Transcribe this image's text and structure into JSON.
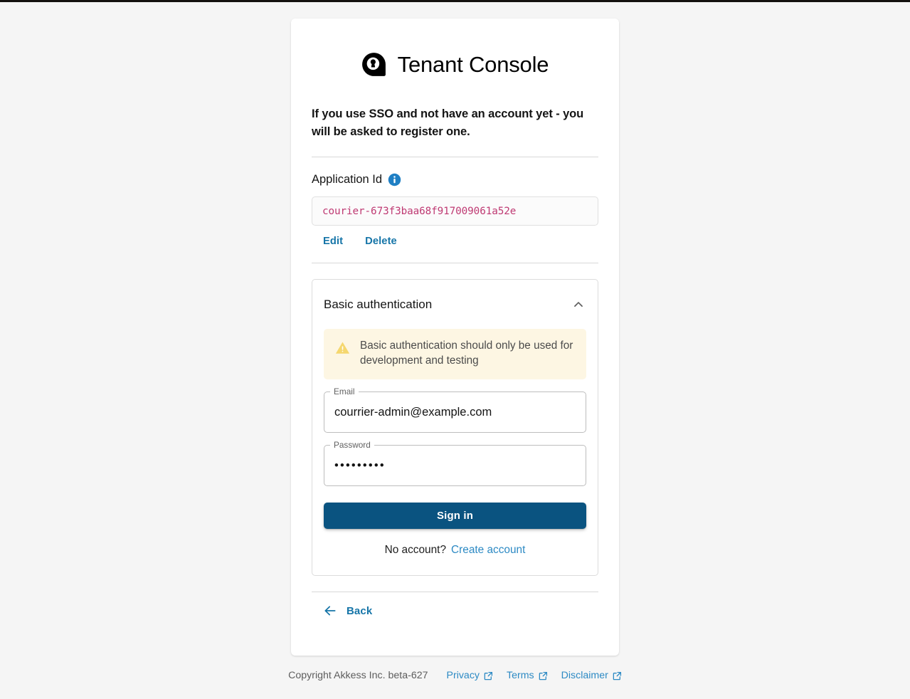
{
  "brand": {
    "logo_icon": "akkess-pin-lock-logo",
    "title": "Tenant Console"
  },
  "intro": {
    "text": "If you use SSO and not have an account yet - you will be asked to register one."
  },
  "application_id": {
    "label": "Application Id",
    "info_icon": "info-circle-icon",
    "value": "courier-673f3baa68f917009061a52e",
    "edit_label": "Edit",
    "delete_label": "Delete"
  },
  "basic_auth": {
    "title": "Basic authentication",
    "collapse_icon": "chevron-up-icon",
    "expanded": true,
    "warning": {
      "icon": "warning-triangle-icon",
      "text": "Basic authentication should only be used for development and testing"
    },
    "email": {
      "label": "Email",
      "value": "courrier-admin@example.com",
      "placeholder": ""
    },
    "password": {
      "label": "Password",
      "value": "•••••••••",
      "placeholder": ""
    },
    "signin_label": "Sign in",
    "no_account_text": "No account?",
    "create_account_label": "Create account"
  },
  "back": {
    "icon": "arrow-left-icon",
    "label": "Back"
  },
  "footer": {
    "copyright": "Copyright Akkess Inc. beta-627",
    "links": [
      {
        "label": "Privacy",
        "icon": "external-link-icon"
      },
      {
        "label": "Terms",
        "icon": "external-link-icon"
      },
      {
        "label": "Disclaimer",
        "icon": "external-link-icon"
      }
    ]
  },
  "colors": {
    "page_background": "#f5f5f5",
    "card_background": "#ffffff",
    "primary_button": "#0a5380",
    "link": "#1675a8",
    "link_soft": "#2d8ac4",
    "code_text": "#bf3a73",
    "warning_background": "#fdf6e3",
    "warning_icon": "#f5d76e",
    "info_icon": "#1f7fc4"
  }
}
